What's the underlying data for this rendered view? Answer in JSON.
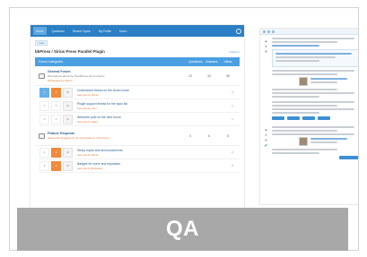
{
  "forum_shot": {
    "nav_tabs": [
      "Home",
      "Questions",
      "Recent Topics",
      "My Profile",
      "Users"
    ],
    "breadcrumb": "Index",
    "title": "bbPress / Sirius Press Parallel Plugin",
    "stats": "Statistics",
    "header": {
      "name": "Forum Categories",
      "cols": [
        "Questions",
        "Answers",
        "Views"
      ]
    },
    "categories": [
      {
        "name": "General Forum",
        "desc": "Discussions about the WordPress Forum theme",
        "desc2": "Moderated by Admin",
        "nums": [
          "12",
          "34",
          "56"
        ],
        "topics": [
          {
            "votes": "3",
            "answers": "2",
            "views": "54",
            "l1": "Customized thread on the forum home",
            "l2": "Last post by Admin",
            "side": "4"
          },
          {
            "votes": "1",
            "answers": "5",
            "views": "23",
            "l1": "Plugin support thread for the topic list",
            "l2": "Last post by User",
            "side": "2"
          },
          {
            "votes": "0",
            "answers": "1",
            "views": "12",
            "l1": "Welcome post on the new forum",
            "l2": "Last post by Editor",
            "side": "1"
          }
        ]
      },
      {
        "name": "Feature Requests",
        "desc": "Ideas and suggestions for new features of the forum",
        "nums": [
          "3",
          "5",
          "8"
        ],
        "topics": [
          {
            "votes": "2",
            "answers": "3",
            "views": "19",
            "l1": "Sticky topics and announcements",
            "l2": "Last post by Admin",
            "side": "2"
          },
          {
            "votes": "4",
            "answers": "0",
            "views": "31",
            "l1": "Badges for users and reputation",
            "l2": "Last post by Moderator",
            "side": "0"
          }
        ]
      }
    ]
  },
  "qa_shot": {
    "question_votes": "5",
    "answer_votes": "2"
  },
  "banner": {
    "label": "QA"
  },
  "colors": {
    "nav": "#2b7fc4",
    "accent_blue": "#4aa0e2",
    "accent_orange": "#f08a3c",
    "banner": "#a8a8a8"
  },
  "icons": [
    "search-icon",
    "forum-category-icon",
    "vote-up-icon",
    "vote-down-icon",
    "accepted-check-icon",
    "avatar"
  ]
}
